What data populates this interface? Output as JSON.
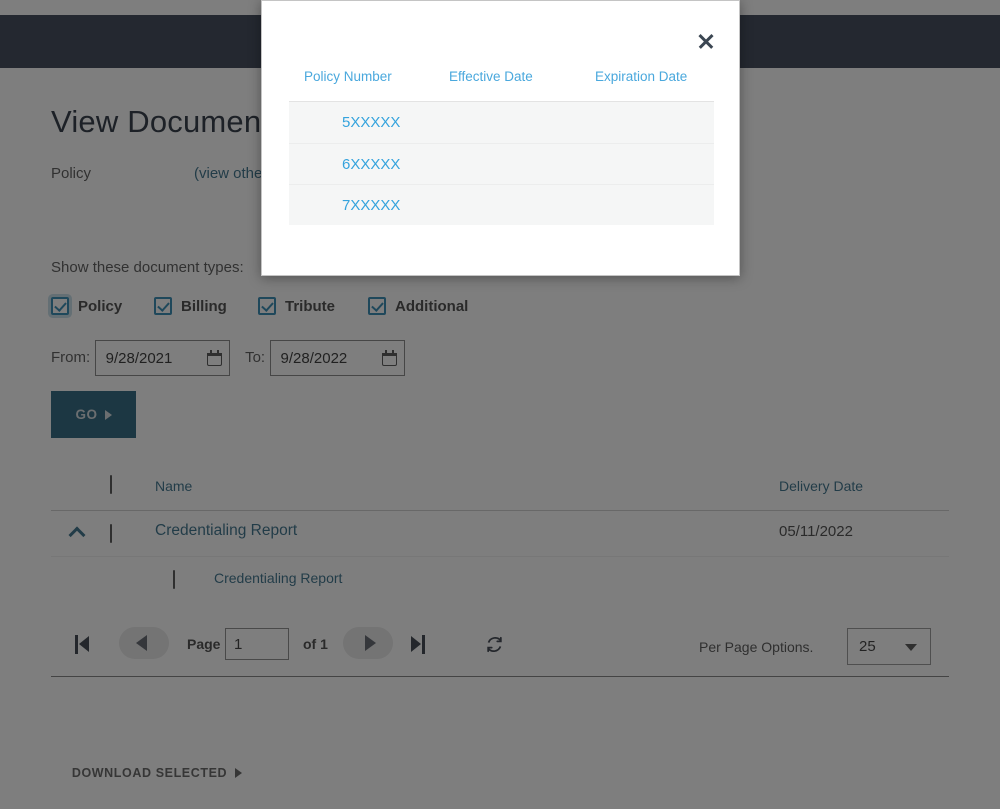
{
  "page": {
    "title": "View Documents",
    "policy_label": "Policy",
    "policy_link": "(view other policies)",
    "show_types_label": "Show these document types:",
    "document_types": [
      {
        "label": "Policy",
        "checked": true
      },
      {
        "label": "Billing",
        "checked": true
      },
      {
        "label": "Tribute",
        "checked": true
      },
      {
        "label": "Additional",
        "checked": true
      }
    ],
    "date_filter": {
      "from_label": "From:",
      "from_value": "9/28/2021",
      "to_label": "To:",
      "to_value": "9/28/2022",
      "calendar_icon": "calendar-icon"
    },
    "go_button": "GO",
    "download_button": "DOWNLOAD SELECTED"
  },
  "grid": {
    "columns": [
      "Name",
      "Delivery Date"
    ],
    "select_all_checkbox": false,
    "rows": [
      {
        "expanded": true,
        "checked": false,
        "name": "Credentialing Report",
        "delivery_date": "05/11/2022",
        "children": [
          {
            "checked": false,
            "name": "Credentialing Report"
          }
        ]
      }
    ]
  },
  "pager": {
    "first_icon": "first-page-icon",
    "prev_icon": "previous-page-icon",
    "page_label": "Page",
    "page_value": "1",
    "of_label": "of 1",
    "next_icon": "next-page-icon",
    "last_icon": "last-page-icon",
    "refresh_icon": "refresh-icon",
    "per_page_label": "Per Page Options.",
    "per_page_value": "25"
  },
  "modal": {
    "close_icon": "close-icon",
    "columns": [
      "Policy Number",
      "Effective Date",
      "Expiration Date"
    ],
    "rows": [
      {
        "policy_number": "5XXXXX",
        "effective_date": "",
        "expiration_date": ""
      },
      {
        "policy_number": "6XXXXX",
        "effective_date": "",
        "expiration_date": ""
      },
      {
        "policy_number": "7XXXXX",
        "effective_date": "",
        "expiration_date": ""
      }
    ]
  },
  "colors": {
    "topbar": "#20293d",
    "accent_link": "#1b5b79",
    "modal_link": "#35a3dd",
    "go_button": "#0b4f6c",
    "checkbox": "#1279a8"
  }
}
